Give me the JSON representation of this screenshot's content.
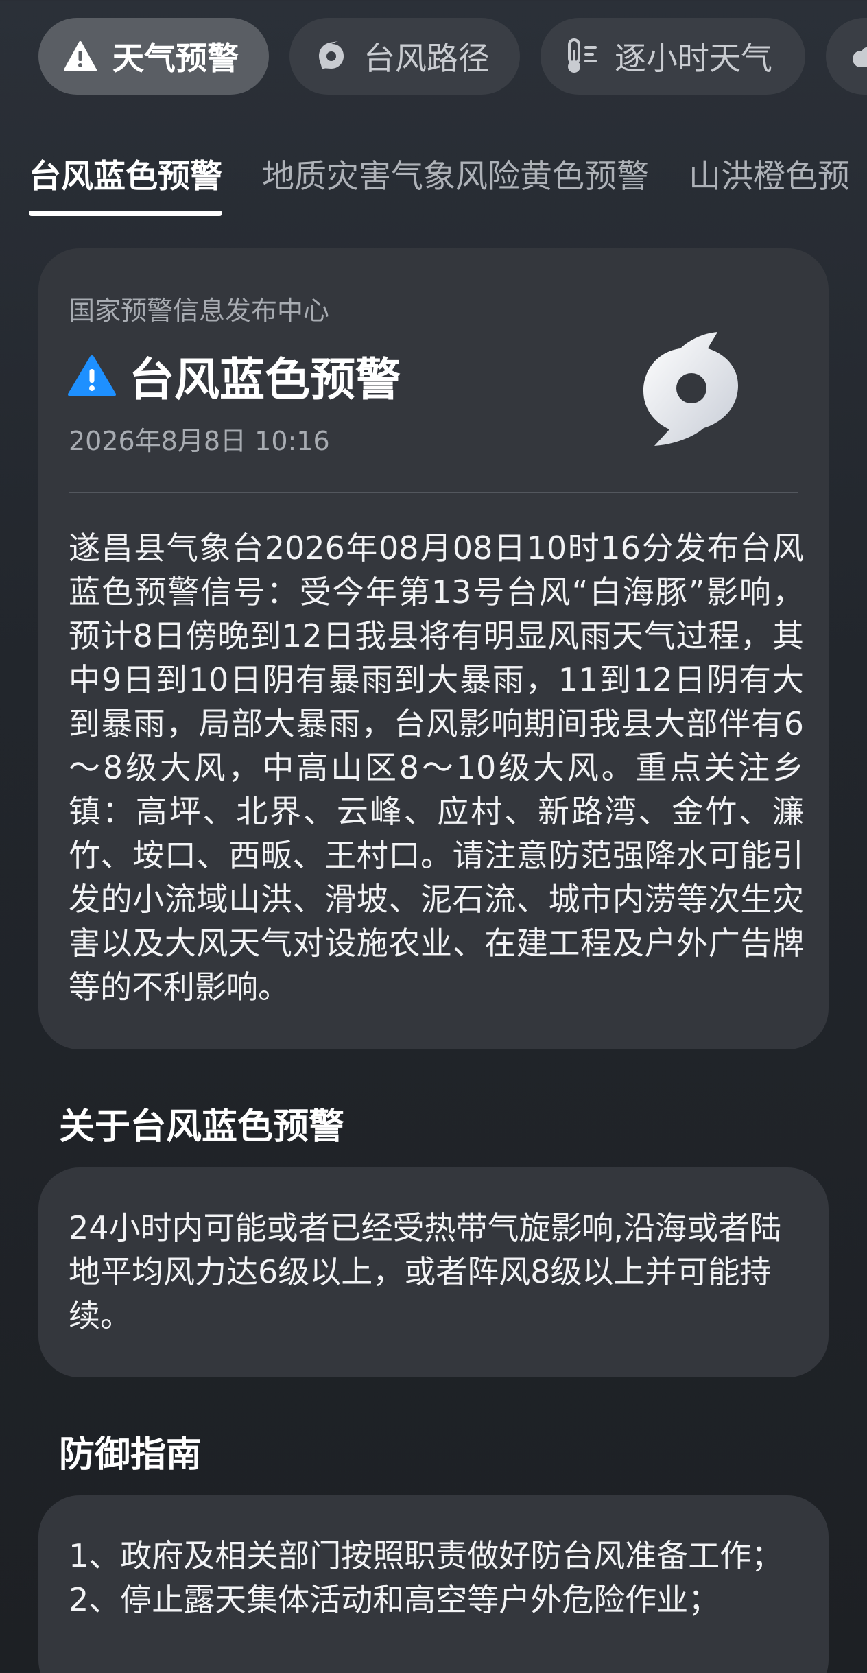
{
  "chips": [
    {
      "label": "天气预警",
      "icon": "warning-triangle-icon",
      "active": true
    },
    {
      "label": "台风路径",
      "icon": "typhoon-icon",
      "active": false
    },
    {
      "label": "逐小时天气",
      "icon": "thermometer-icon",
      "active": false
    },
    {
      "label": "",
      "icon": "cloud-icon",
      "active": false
    }
  ],
  "tabs": [
    {
      "label": "台风蓝色预警",
      "active": true
    },
    {
      "label": "地质灾害气象风险黄色预警",
      "active": false
    },
    {
      "label": "山洪橙色预",
      "active": false
    }
  ],
  "warning": {
    "source": "国家预警信息发布中心",
    "title": "台风蓝色预警",
    "time": "2026年8月8日 10:16",
    "body": "遂昌县气象台2026年08月08日10时16分发布台风蓝色预警信号：受今年第13号台风“白海豚”影响，预计8日傍晚到12日我县将有明显风雨天气过程，其中9日到10日阴有暴雨到大暴雨，11到12日阴有大到暴雨，局部大暴雨，台风影响期间我县大部伴有6～8级大风，中高山区8～10级大风。重点关注乡镇：高坪、北界、云峰、应村、新路湾、金竹、濂竹、垵口、西畈、王村口。请注意防范强降水可能引发的小流域山洪、滑坡、泥石流、城市内涝等次生灾害以及大风天气对设施农业、在建工程及户外广告牌等的不利影响。",
    "icon_color": "#1e90ff"
  },
  "about": {
    "title": "关于台风蓝色预警",
    "text": "24小时内可能或者已经受热带气旋影响,沿海或者陆地平均风力达6级以上，或者阵风8级以上并可能持续。"
  },
  "guide": {
    "title": "防御指南",
    "lines": [
      "1、政府及相关部门按照职责做好防台风准备工作；",
      "2、停止露天集体活动和高空等户外危险作业；"
    ]
  }
}
